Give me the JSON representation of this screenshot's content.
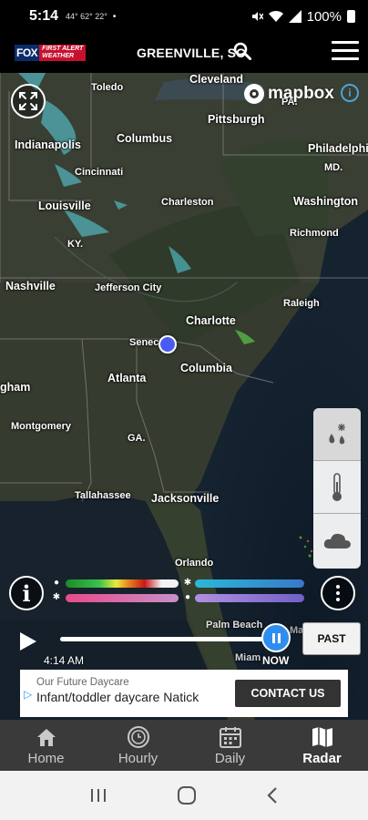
{
  "status_bar": {
    "time": "5:14",
    "temps": "44° 62° 22°",
    "dot": "•",
    "battery": "100%"
  },
  "header": {
    "logo_fox": "FOX",
    "logo_line1": "FIRST ALERT",
    "logo_line2": "WEATHER",
    "location": "GREENVILLE, SC"
  },
  "map": {
    "attribution_brand": "mapbox",
    "cities": [
      {
        "name": "Toledo",
        "size": "small"
      },
      {
        "name": "Cleveland",
        "size": "normal"
      },
      {
        "name": "Pittsburgh",
        "size": "normal"
      },
      {
        "name": "PA.",
        "size": "small"
      },
      {
        "name": "Indianapolis",
        "size": "normal"
      },
      {
        "name": "Columbus",
        "size": "normal"
      },
      {
        "name": "Philadelphi",
        "size": "normal"
      },
      {
        "name": "Cincinnati",
        "size": "small"
      },
      {
        "name": "MD.",
        "size": "small"
      },
      {
        "name": "Louisville",
        "size": "normal"
      },
      {
        "name": "Charleston",
        "size": "small"
      },
      {
        "name": "Washington",
        "size": "normal"
      },
      {
        "name": "KY.",
        "size": "small"
      },
      {
        "name": "Richmond",
        "size": "small"
      },
      {
        "name": "Nashville",
        "size": "normal"
      },
      {
        "name": "Jefferson City",
        "size": "small"
      },
      {
        "name": "Raleigh",
        "size": "small"
      },
      {
        "name": "Charlotte",
        "size": "normal"
      },
      {
        "name": "Senec",
        "size": "small"
      },
      {
        "name": "Columbia",
        "size": "normal"
      },
      {
        "name": "gham",
        "size": "normal"
      },
      {
        "name": "Atlanta",
        "size": "normal"
      },
      {
        "name": "Montgomery",
        "size": "small"
      },
      {
        "name": "GA.",
        "size": "small"
      },
      {
        "name": "Tallahassee",
        "size": "small"
      },
      {
        "name": "Jacksonville",
        "size": "normal"
      },
      {
        "name": "Orlando",
        "size": "small"
      },
      {
        "name": "Palm Beach",
        "size": "small"
      },
      {
        "name": "Marsh Harbour",
        "size": "small"
      },
      {
        "name": "Miam",
        "size": "small"
      }
    ]
  },
  "layers": {
    "items": [
      {
        "name": "precipitation-layer",
        "icon": "snow-rain-icon",
        "active": true
      },
      {
        "name": "temperature-layer",
        "icon": "thermometer-icon",
        "active": false
      },
      {
        "name": "clouds-layer",
        "icon": "cloud-icon",
        "active": false
      }
    ]
  },
  "legend": {
    "rain_colors": [
      "#1a8a2a",
      "#3cc24a",
      "#e8e840",
      "#e88a20",
      "#c81818",
      "#f2f2f2"
    ],
    "snow_colors": [
      "#2ab8d8",
      "#3a78c8"
    ],
    "mix_colors": [
      "#e84a8a",
      "#c890c8"
    ],
    "ice_colors": [
      "#b090e0",
      "#7060c8"
    ]
  },
  "timeline": {
    "start_time": "4:14 AM",
    "current_label": "NOW",
    "past_button": "PAST",
    "progress": 1.0
  },
  "ad": {
    "line1": "Our Future Daycare",
    "line2": "Infant/toddler daycare Natick",
    "cta": "CONTACT US"
  },
  "bottom_nav": {
    "items": [
      {
        "label": "Home",
        "icon": "home-icon",
        "active": false
      },
      {
        "label": "Hourly",
        "icon": "clock-icon",
        "active": false
      },
      {
        "label": "Daily",
        "icon": "calendar-icon",
        "active": false
      },
      {
        "label": "Radar",
        "icon": "map-icon",
        "active": true
      }
    ]
  },
  "colors": {
    "accent": "#2f8df0",
    "location_dot": "#4a5cf0",
    "brand_red": "#c8102e",
    "brand_blue": "#0b2b6b"
  }
}
